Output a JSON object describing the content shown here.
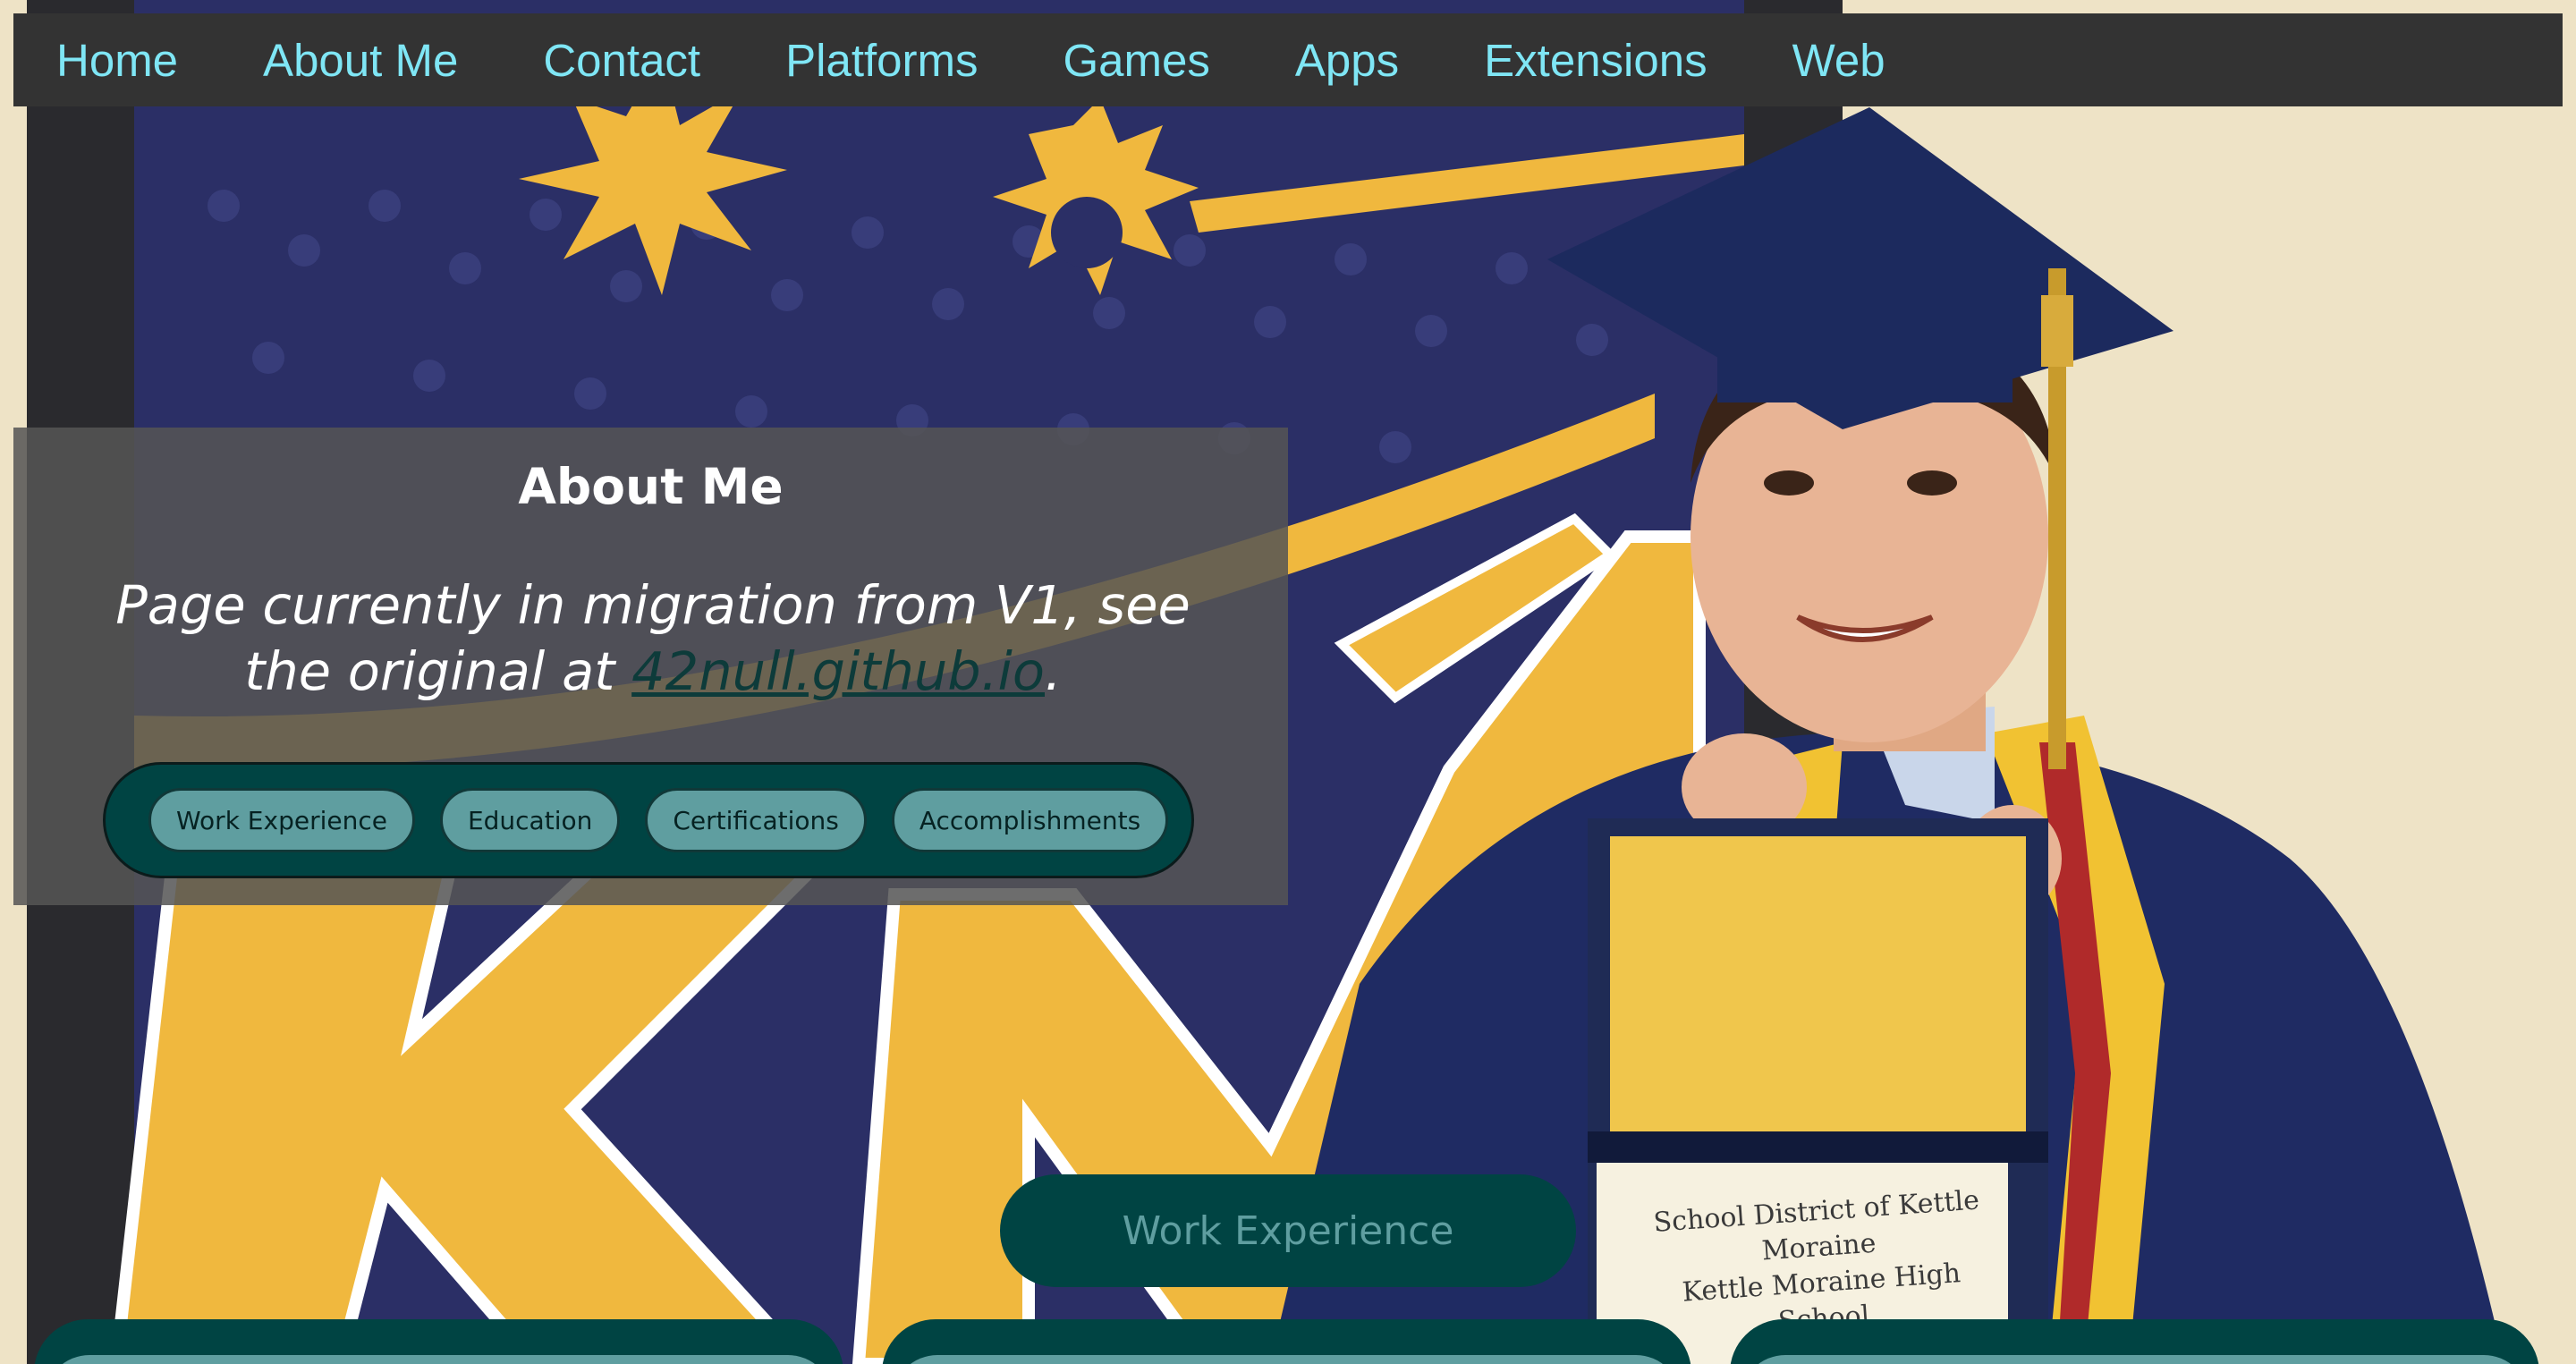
{
  "nav": {
    "items": [
      {
        "label": "Home"
      },
      {
        "label": "About Me"
      },
      {
        "label": "Contact"
      },
      {
        "label": "Platforms"
      },
      {
        "label": "Games"
      },
      {
        "label": "Apps"
      },
      {
        "label": "Extensions"
      },
      {
        "label": "Web"
      }
    ]
  },
  "about": {
    "title": "About Me",
    "subtitle_prefix": "Page currently in migration from V1, see the original at ",
    "link_text": "42null.github.io",
    "subtitle_suffix": ".",
    "pills": [
      {
        "label": "Work Experience"
      },
      {
        "label": "Education"
      },
      {
        "label": "Certifications"
      },
      {
        "label": "Accomplishments"
      }
    ]
  },
  "section": {
    "header": "Work Experience"
  },
  "diploma": {
    "line1": "School District of Kettle Moraine",
    "line2": "Kettle Moraine High School"
  },
  "colors": {
    "nav_bg": "#333333",
    "nav_link": "#7fe6f5",
    "dark_teal": "#004443",
    "teal": "#5f9ea0",
    "panel": "#555555"
  }
}
